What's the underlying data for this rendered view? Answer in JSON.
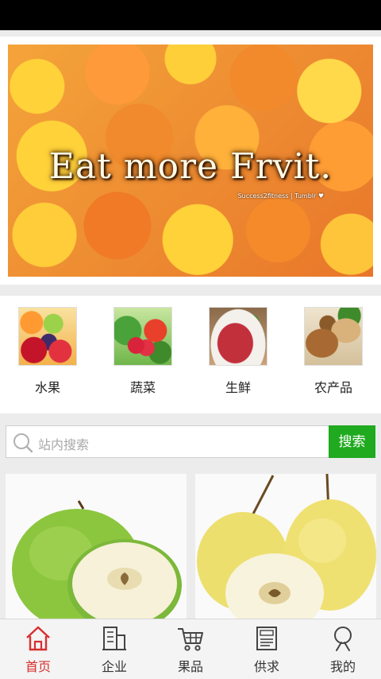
{
  "banner": {
    "title": "Eat more Frvit.",
    "credit": "Success2fitness | Tumblr ♥"
  },
  "categories": [
    {
      "label": "水果",
      "icon": "fruit-image"
    },
    {
      "label": "蔬菜",
      "icon": "vegetable-image"
    },
    {
      "label": "生鲜",
      "icon": "fresh-meat-image"
    },
    {
      "label": "农产品",
      "icon": "farm-produce-image"
    }
  ],
  "search": {
    "placeholder": "站内搜索",
    "button_label": "搜索",
    "button_color": "#1faa1f"
  },
  "products": [
    {
      "icon": "green-apple-image"
    },
    {
      "icon": "pear-image"
    }
  ],
  "tabbar": {
    "active_color": "#d82f2f",
    "items": [
      {
        "label": "首页",
        "icon": "home-icon",
        "active": true
      },
      {
        "label": "企业",
        "icon": "building-icon",
        "active": false
      },
      {
        "label": "果品",
        "icon": "cart-icon",
        "active": false
      },
      {
        "label": "供求",
        "icon": "supply-demand-icon",
        "active": false
      },
      {
        "label": "我的",
        "icon": "user-icon",
        "active": false
      }
    ]
  }
}
